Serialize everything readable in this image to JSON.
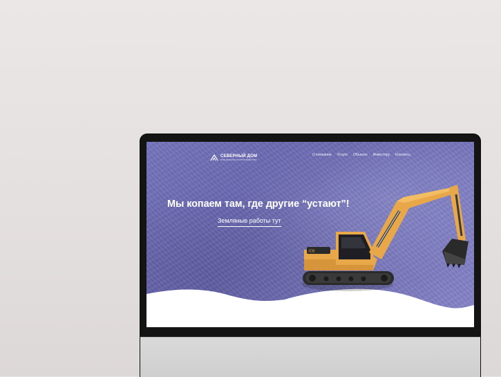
{
  "site": {
    "logo_name": "СЕВЕРНЫЙ ДОМ",
    "logo_tagline": "СПЕЦТЕХНИКА И СТРОИТЕЛЬСТВО"
  },
  "nav": {
    "items": [
      {
        "label": "О компании"
      },
      {
        "label": "Услуги"
      },
      {
        "label": "Объекты"
      },
      {
        "label": "Инвестору"
      },
      {
        "label": "Контакты"
      }
    ]
  },
  "hero": {
    "title": "Мы копаем там, где другие “устают”!",
    "link_label": "Земляные работы тут"
  },
  "colors": {
    "hero_bg": "#6b69b2",
    "wave": "#ffffff",
    "excavator_body": "#e8a84a",
    "monitor_frame": "#141414",
    "monitor_chin": "#d6d6d6"
  },
  "icons": {
    "logo": "house-roof-icon",
    "image": "excavator-image"
  }
}
